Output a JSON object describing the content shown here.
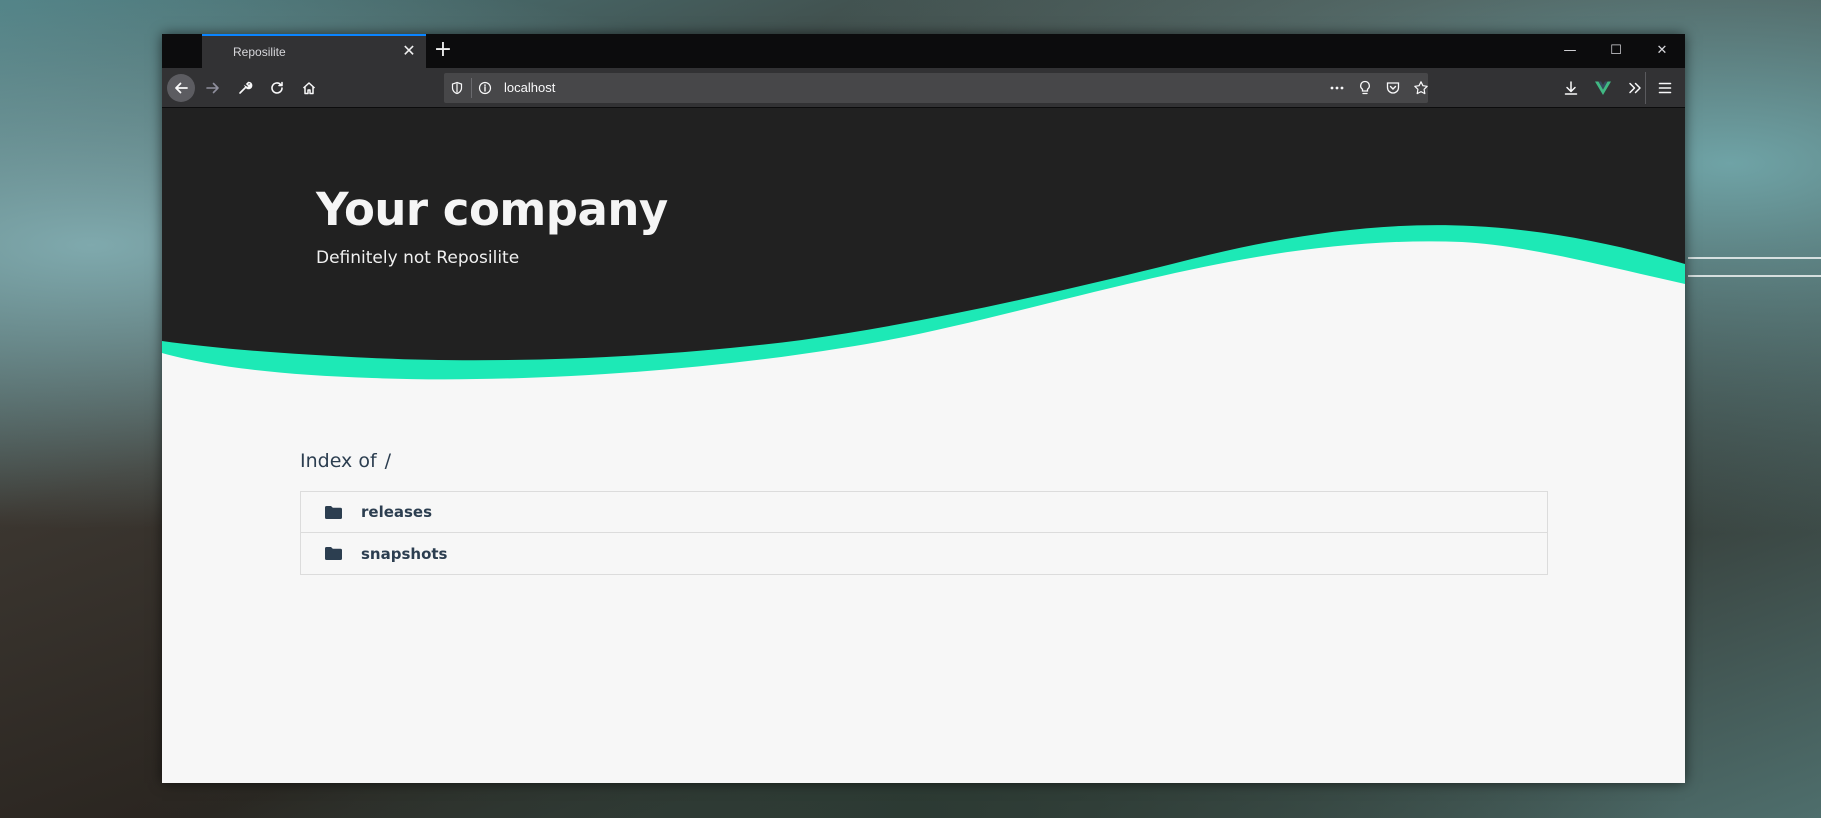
{
  "browser": {
    "tab_title": "Reposilite",
    "tab_close": "✕",
    "new_tab": "+",
    "url": "localhost",
    "window_controls": {
      "minimize": "—",
      "maximize": "☐",
      "close": "✕"
    },
    "accent_color": "#0a84ff"
  },
  "page": {
    "title": "Your company",
    "subtitle": "Definitely not Reposilite",
    "index_label": "Index of",
    "index_path": "/",
    "entries": [
      {
        "name": "releases",
        "icon": "folder-icon"
      },
      {
        "name": "snapshots",
        "icon": "folder-icon"
      }
    ],
    "colors": {
      "hero": "#212121",
      "wave_accent": "#1de9b6",
      "text": "#2c3e50",
      "background": "#f7f7f7"
    }
  }
}
